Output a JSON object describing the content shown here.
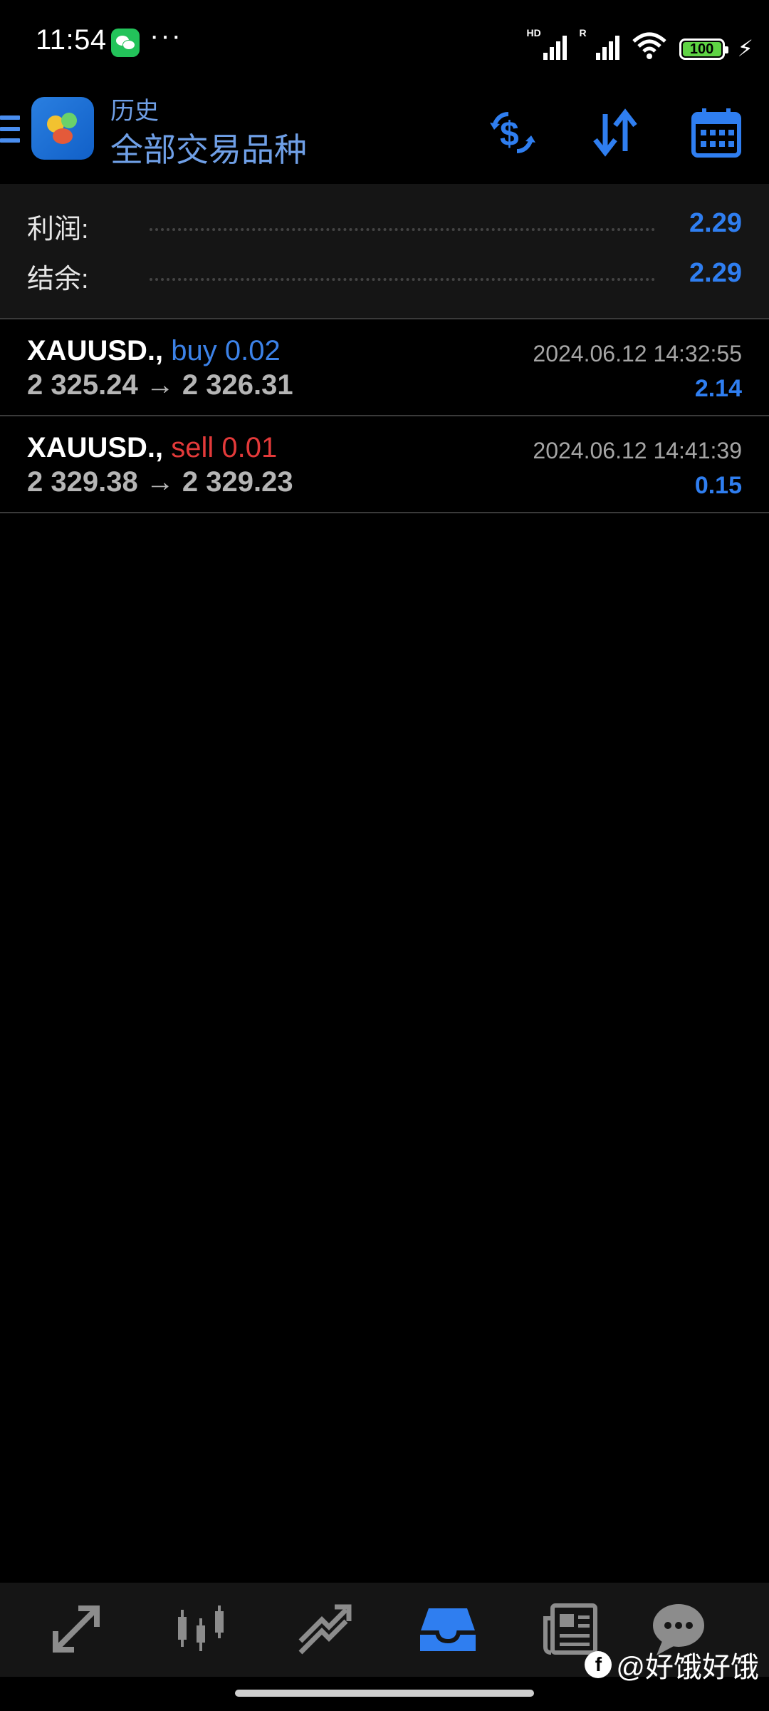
{
  "status_bar": {
    "time": "11:54",
    "more_dots": "···",
    "signal1_tag": "HD",
    "signal2_tag": "R",
    "battery": "100"
  },
  "header": {
    "subtitle": "历史",
    "title": "全部交易品种",
    "accent_color": "#2f7ef0"
  },
  "summary": {
    "rows": [
      {
        "label": "利润:",
        "value": "2.29"
      },
      {
        "label": "结余:",
        "value": "2.29"
      }
    ]
  },
  "trades": [
    {
      "symbol": "XAUUSD.,",
      "side": "buy 0.02",
      "prices": "2 325.24 → 2 326.31",
      "time": "2024.06.12 14:32:55",
      "profit": "2.14"
    },
    {
      "symbol": "XAUUSD.,",
      "side": "sell 0.01",
      "prices": "2 329.38 → 2 329.23",
      "time": "2024.06.12 14:41:39",
      "profit": "0.15"
    }
  ],
  "bottom_nav": {
    "items": [
      {
        "icon": "quotes-icon",
        "active": false
      },
      {
        "icon": "chart-icon",
        "active": false
      },
      {
        "icon": "trade-icon",
        "active": false
      },
      {
        "icon": "history-icon",
        "active": true
      },
      {
        "icon": "news-icon",
        "active": false
      },
      {
        "icon": "chat-icon",
        "active": false
      }
    ]
  },
  "watermark": {
    "text": "@好饿好饿",
    "logo": "f"
  }
}
